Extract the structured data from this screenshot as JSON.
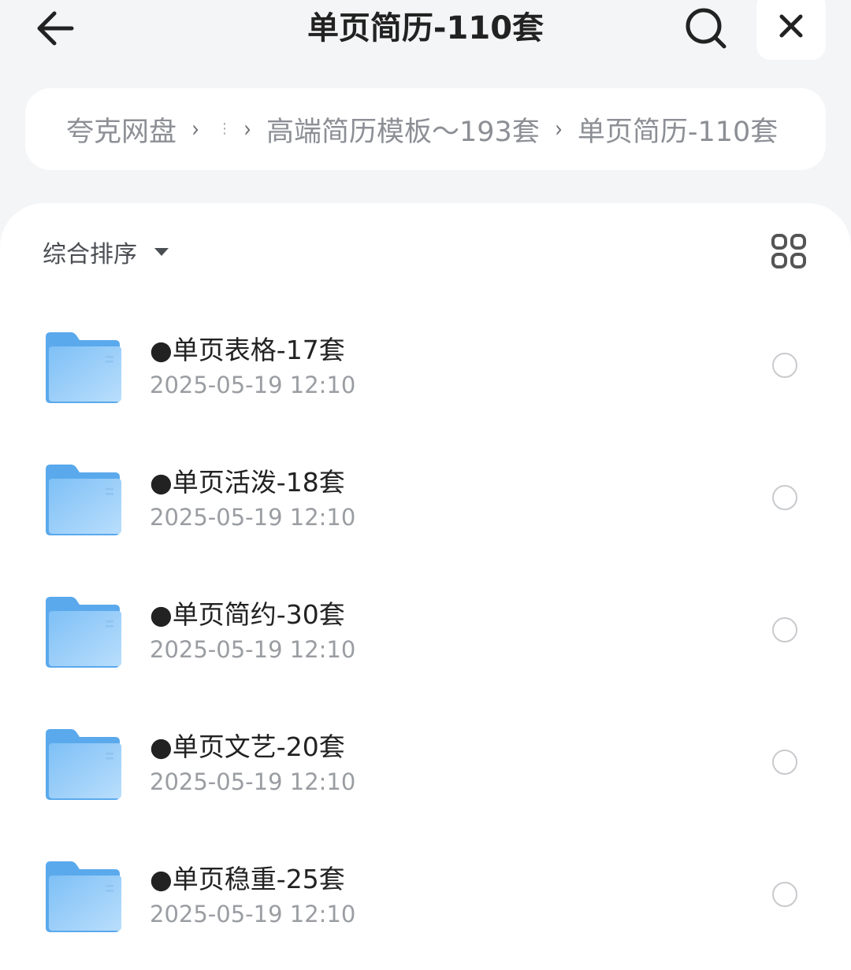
{
  "header": {
    "title": "单页简历-110套",
    "icons": {
      "back": "arrow-left-icon",
      "search": "search-icon",
      "close": "close-icon"
    }
  },
  "breadcrumb": {
    "items": [
      "夸克网盘",
      "高端简历模板～193套",
      "单页简历-110套"
    ],
    "more_glyph": "⋮"
  },
  "toolbar": {
    "sort_label": "综合排序",
    "view_icon": "grid-view-icon"
  },
  "files": [
    {
      "name": "●单页表格-17套",
      "date": "2025-05-19 12:10",
      "type": "folder"
    },
    {
      "name": "●单页活泼-18套",
      "date": "2025-05-19 12:10",
      "type": "folder"
    },
    {
      "name": "●单页简约-30套",
      "date": "2025-05-19 12:10",
      "type": "folder"
    },
    {
      "name": "●单页文艺-20套",
      "date": "2025-05-19 12:10",
      "type": "folder"
    },
    {
      "name": "●单页稳重-25套",
      "date": "2025-05-19 12:10",
      "type": "folder"
    }
  ],
  "colors": {
    "background": "#f4f5f6",
    "card": "#ffffff",
    "folder_light": "#b8dcfb",
    "folder_dark": "#5aa9ec",
    "secondary_text": "#9a9da2"
  }
}
